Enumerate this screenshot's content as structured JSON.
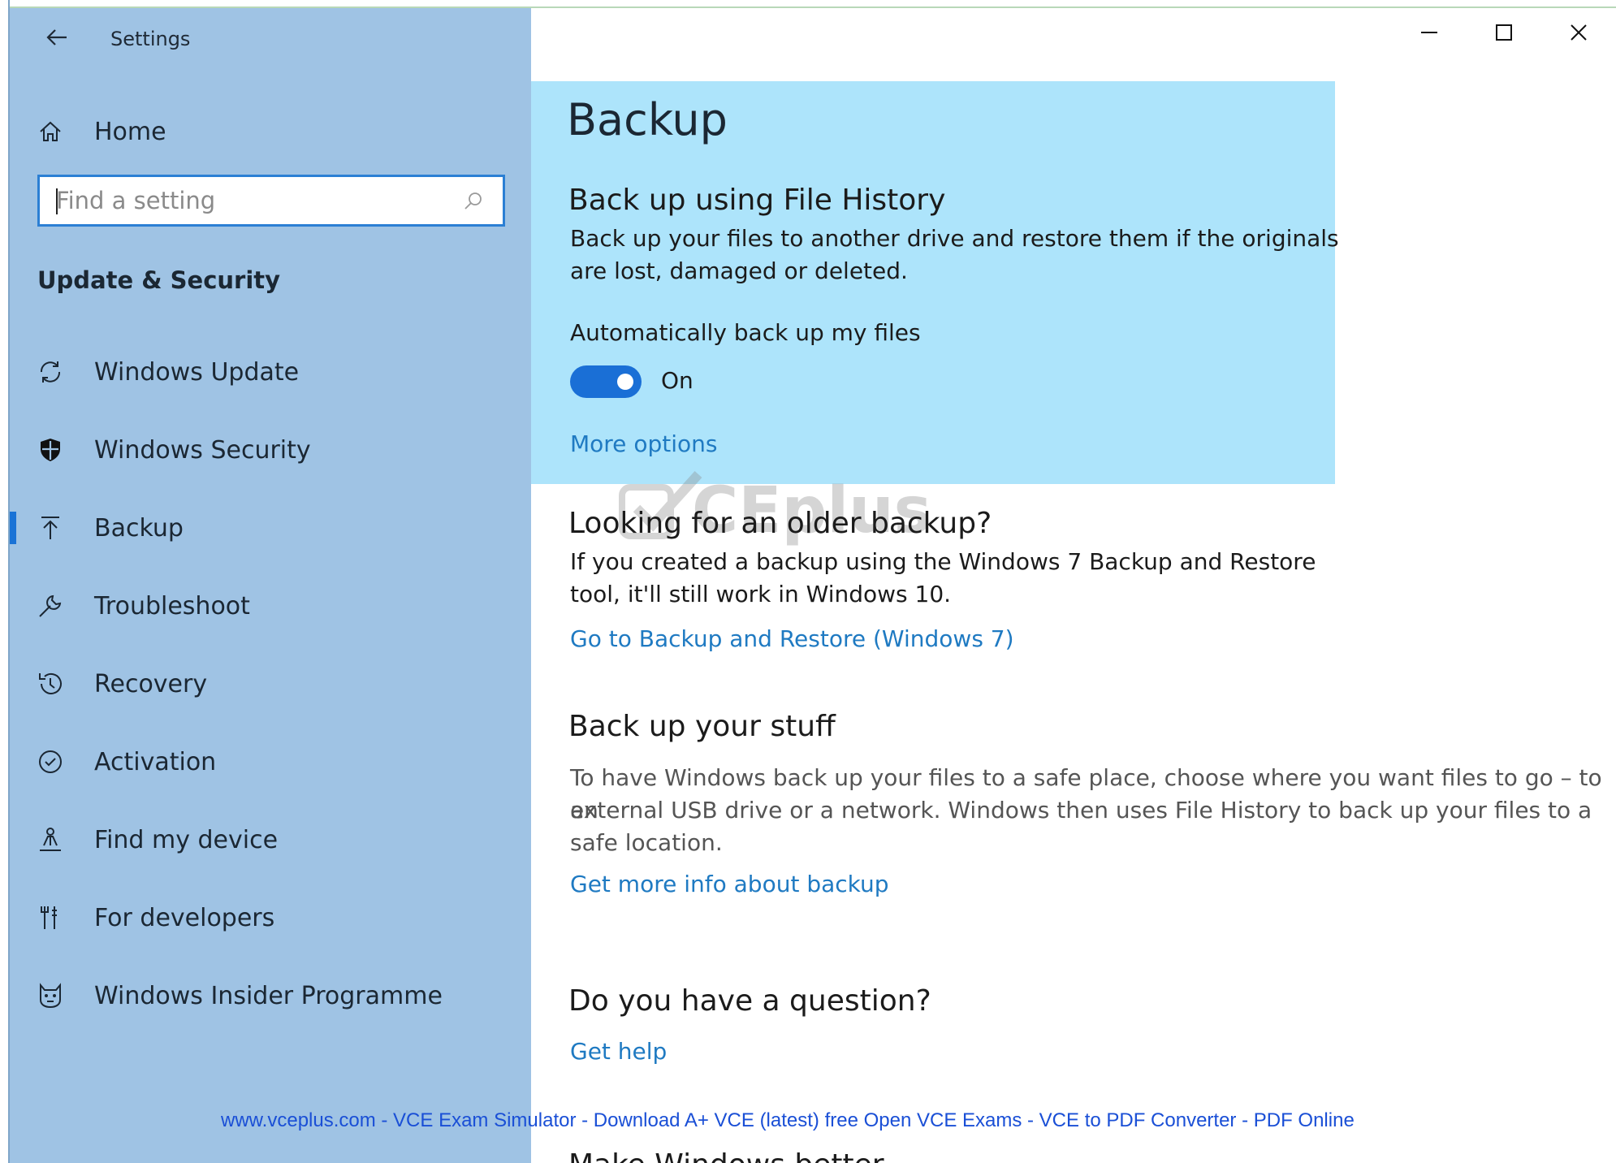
{
  "window": {
    "title": "Settings"
  },
  "sidebar": {
    "home_label": "Home",
    "search": {
      "placeholder": "Find a setting",
      "icon": "search-icon"
    },
    "section_title": "Update & Security",
    "items": [
      {
        "label": "Windows Update",
        "icon": "sync-icon",
        "active": false
      },
      {
        "label": "Windows Security",
        "icon": "shield-icon",
        "active": false
      },
      {
        "label": "Backup",
        "icon": "upload-arrow-icon",
        "active": true
      },
      {
        "label": "Troubleshoot",
        "icon": "wrench-icon",
        "active": false
      },
      {
        "label": "Recovery",
        "icon": "history-icon",
        "active": false
      },
      {
        "label": "Activation",
        "icon": "check-circle-icon",
        "active": false
      },
      {
        "label": "Find my device",
        "icon": "person-location-icon",
        "active": false
      },
      {
        "label": "For developers",
        "icon": "developer-tools-icon",
        "active": false
      },
      {
        "label": "Windows Insider Programme",
        "icon": "insider-cat-icon",
        "active": false
      }
    ]
  },
  "main": {
    "page_title": "Backup",
    "file_history": {
      "heading": "Back up using File History",
      "description_line1": "Back up your files to another drive and restore them if the originals",
      "description_line2": "are lost, damaged or deleted.",
      "auto_backup_label": "Automatically back up my files",
      "toggle_state": "On",
      "more_options_link": "More options"
    },
    "older_backup": {
      "heading": "Looking for an older backup?",
      "description_line1": "If you created a backup using the Windows 7 Backup and Restore",
      "description_line2": "tool, it'll still work in Windows 10.",
      "link": "Go to Backup and Restore (Windows 7)"
    },
    "backup_stuff": {
      "heading": "Back up your stuff",
      "description_line1": "To have Windows back up your files to a safe place, choose where you want files to go – to an",
      "description_line2": "external USB drive or a network. Windows then uses File History to back up your files to a",
      "description_line3": "safe location.",
      "link": "Get more info about backup"
    },
    "question": {
      "heading": "Do you have a question?",
      "link": "Get help"
    },
    "cut_off_heading": "Make Windows better"
  },
  "watermark": {
    "text": "CEplus"
  },
  "footer_banner": "www.vceplus.com - VCE Exam Simulator - Download A+ VCE (latest) free Open VCE Exams - VCE to PDF Converter - PDF Online",
  "colors": {
    "sidebar_bg": "#9fc3e4",
    "highlight_bg": "#ade4fb",
    "accent": "#1a6fd6",
    "link": "#1f7ac2"
  }
}
